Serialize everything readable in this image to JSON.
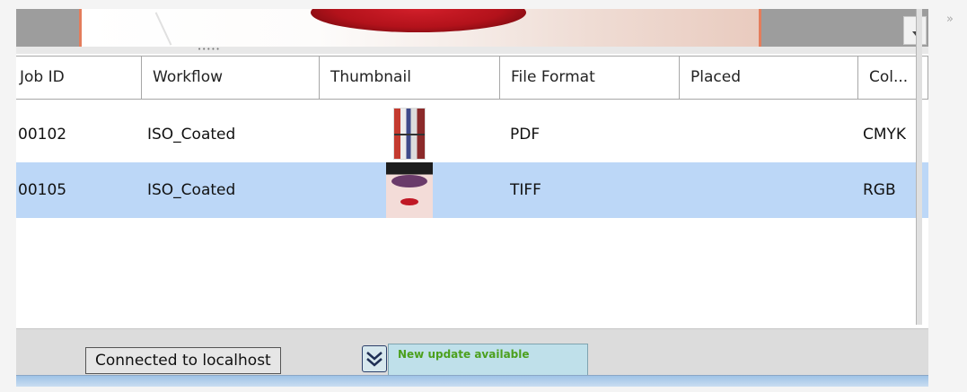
{
  "table": {
    "columns": [
      "Job ID",
      "Workflow",
      "Thumbnail",
      "File Format",
      "Placed",
      "Col..."
    ],
    "rows": [
      {
        "job_id": "00102",
        "workflow": "ISO_Coated",
        "thumbnail": "collage-thumbnail",
        "file_format": "PDF",
        "placed": "",
        "color": "CMYK",
        "selected": false
      },
      {
        "job_id": "00105",
        "workflow": "ISO_Coated",
        "thumbnail": "face-thumbnail",
        "file_format": "TIFF",
        "placed": "",
        "color": "RGB",
        "selected": true
      }
    ]
  },
  "preview": {
    "dropdown_icon": "chevron-down-icon",
    "expander_icon": "double-chevron-right-icon",
    "expander_glyph": "»"
  },
  "status": {
    "connection": "Connected to localhost",
    "update_icon": "double-chevron-down-icon",
    "update_text": "New update available"
  },
  "colors": {
    "selection": "#bcd7f7",
    "update_bg": "#bfe0ea",
    "update_text": "#4ca01e",
    "accent_border": "#e47d5c"
  }
}
